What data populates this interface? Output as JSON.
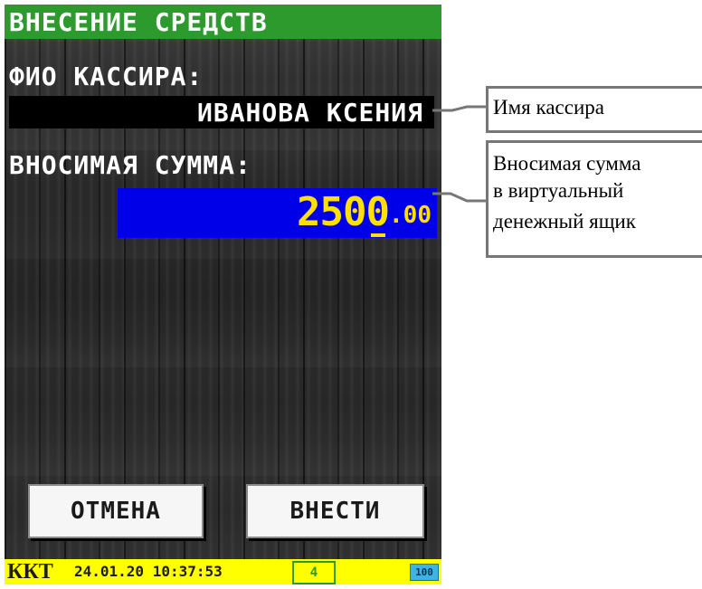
{
  "screen": {
    "title": "ВНЕСЕНИЕ СРЕДСТВ",
    "cashier_label": "ФИО КАССИРА:",
    "cashier_name": "ИВАНОВА КСЕНИЯ",
    "sum_label": "ВНОСИМАЯ СУММА:",
    "sum_amount": "2500",
    "sum_cents": ".00",
    "buttons": {
      "cancel": "ОТМЕНА",
      "submit": "ВНЕСТИ"
    },
    "status_bar": {
      "device": "ККТ",
      "datetime": "24.01.20 10:37:53",
      "counter": "4",
      "battery": "100"
    }
  },
  "callouts": {
    "cashier_name": "Имя кассира",
    "sum_lines": [
      "Вносимая сумма",
      "в виртуальный",
      "денежный ящик"
    ]
  },
  "colors": {
    "title_bar": "#2c9a2c",
    "sum_field": "#0000e8",
    "sum_digits": "#ffe000",
    "status_bar": "#ffff00",
    "callout_border": "#777777"
  }
}
